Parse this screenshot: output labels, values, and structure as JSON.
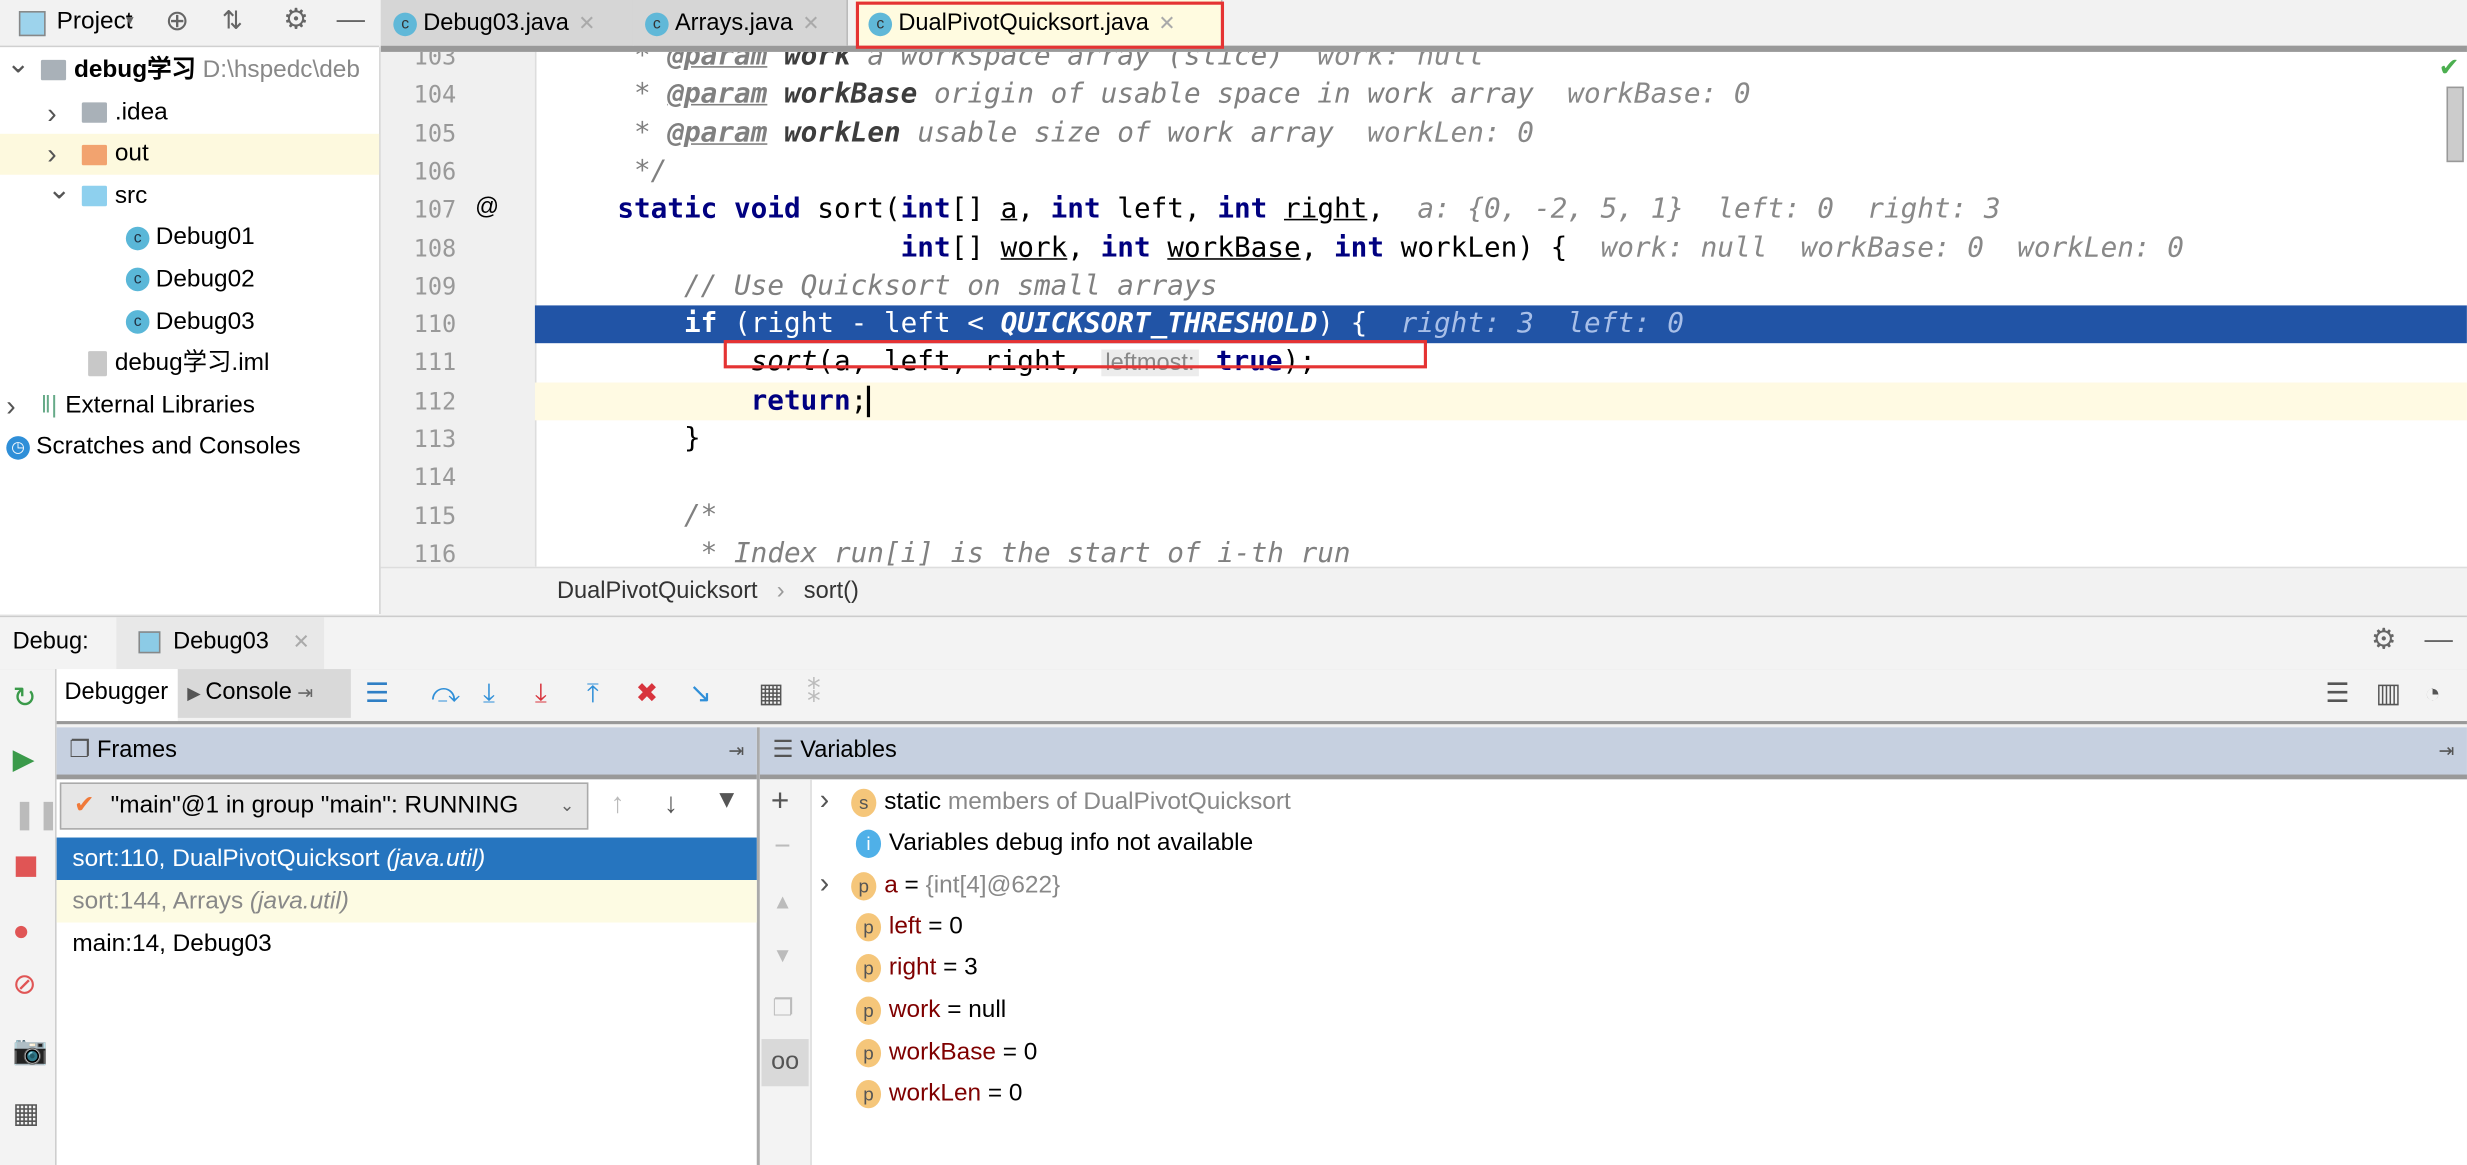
{
  "project_bar": {
    "label": "Project",
    "icons": [
      "locate-icon",
      "collapse-icon",
      "gear-icon",
      "minimize-icon"
    ]
  },
  "tabs": [
    {
      "label": "Debug03.java",
      "active": false
    },
    {
      "label": "Arrays.java",
      "active": false
    },
    {
      "label": "DualPivotQuicksort.java",
      "active": true
    }
  ],
  "tree": [
    {
      "label": "debug学习",
      "extra": "D:\\hspedc\\deb",
      "type": "module",
      "expanded": true
    },
    {
      "label": ".idea",
      "type": "folder-gray",
      "expanded": false
    },
    {
      "label": "out",
      "type": "folder-orange",
      "expanded": false
    },
    {
      "label": "src",
      "type": "folder-blue",
      "expanded": true
    },
    {
      "label": "Debug01",
      "type": "class"
    },
    {
      "label": "Debug02",
      "type": "class"
    },
    {
      "label": "Debug03",
      "type": "class"
    },
    {
      "label": "debug学习.iml",
      "type": "file"
    },
    {
      "label": "External Libraries",
      "type": "libs",
      "expanded": false
    },
    {
      "label": "Scratches and Consoles",
      "type": "scratch"
    }
  ],
  "editor": {
    "lines": [
      {
        "n": "103",
        "tokens": [
          {
            "t": "     * ",
            "c": "cm"
          },
          {
            "t": "@param",
            "c": "tag"
          },
          {
            "t": " work",
            "c": "tagv"
          },
          {
            "t": " a workspace array (slice)",
            "c": "cm"
          },
          {
            "t": "  work: null",
            "c": "hint"
          }
        ]
      },
      {
        "n": "104",
        "tokens": [
          {
            "t": "     * ",
            "c": "cm"
          },
          {
            "t": "@param",
            "c": "tag"
          },
          {
            "t": " workBase",
            "c": "tagv"
          },
          {
            "t": " origin of usable space in work array",
            "c": "cm"
          },
          {
            "t": "  workBase: 0",
            "c": "hint"
          }
        ]
      },
      {
        "n": "105",
        "tokens": [
          {
            "t": "     * ",
            "c": "cm"
          },
          {
            "t": "@param",
            "c": "tag"
          },
          {
            "t": " workLen",
            "c": "tagv"
          },
          {
            "t": " usable size of work array",
            "c": "cm"
          },
          {
            "t": "  workLen: 0",
            "c": "hint"
          }
        ]
      },
      {
        "n": "106",
        "tokens": [
          {
            "t": "     */",
            "c": "cm"
          }
        ]
      },
      {
        "n": "107",
        "marker": "@",
        "tokens": [
          {
            "t": "    "
          },
          {
            "t": "static void ",
            "c": "kw"
          },
          {
            "t": "sort("
          },
          {
            "t": "int",
            "c": "kw"
          },
          {
            "t": "[] "
          },
          {
            "t": "a",
            "c": "ul"
          },
          {
            "t": ", "
          },
          {
            "t": "int",
            "c": "kw"
          },
          {
            "t": " left, "
          },
          {
            "t": "int",
            "c": "kw"
          },
          {
            "t": " "
          },
          {
            "t": "right",
            "c": "ul"
          },
          {
            "t": ",  "
          },
          {
            "t": "a: {0, -2, 5, 1}  left: 0  right: 3",
            "c": "hint"
          }
        ]
      },
      {
        "n": "108",
        "tokens": [
          {
            "t": "                     "
          },
          {
            "t": "int",
            "c": "kw"
          },
          {
            "t": "[] "
          },
          {
            "t": "work",
            "c": "ul"
          },
          {
            "t": ", "
          },
          {
            "t": "int",
            "c": "kw"
          },
          {
            "t": " "
          },
          {
            "t": "workBase",
            "c": "ul"
          },
          {
            "t": ", "
          },
          {
            "t": "int",
            "c": "kw"
          },
          {
            "t": " workLen) {  "
          },
          {
            "t": "work: null  workBase: 0  workLen: 0",
            "c": "hint"
          }
        ]
      },
      {
        "n": "109",
        "tokens": [
          {
            "t": "        "
          },
          {
            "t": "// Use Quicksort on small arrays",
            "c": "cm"
          }
        ]
      },
      {
        "n": "110",
        "state": "execution",
        "tokens": [
          {
            "t": "        "
          },
          {
            "t": "if",
            "c": "kw"
          },
          {
            "t": " (right - left < "
          },
          {
            "t": "QUICKSORT_THRESHOLD",
            "c": "cst"
          },
          {
            "t": ") {  "
          },
          {
            "t": "right: 3  left: 0",
            "c": "hint"
          }
        ]
      },
      {
        "n": "111",
        "tokens": [
          {
            "t": "            "
          },
          {
            "t": "sort",
            "c": "fn"
          },
          {
            "t": "(a, left, right, "
          },
          {
            "t": "leftmost:",
            "c": "phint"
          },
          {
            "t": " "
          },
          {
            "t": "true",
            "c": "kw"
          },
          {
            "t": ");"
          }
        ]
      },
      {
        "n": "112",
        "state": "caret",
        "tokens": [
          {
            "t": "            "
          },
          {
            "t": "return",
            "c": "kw"
          },
          {
            "t": ";"
          }
        ]
      },
      {
        "n": "113",
        "tokens": [
          {
            "t": "        }"
          }
        ]
      },
      {
        "n": "114",
        "tokens": []
      },
      {
        "n": "115",
        "tokens": [
          {
            "t": "        "
          },
          {
            "t": "/*",
            "c": "cm"
          }
        ]
      },
      {
        "n": "116",
        "tokens": [
          {
            "t": "         "
          },
          {
            "t": "* Index run[i] is the start of i-th run",
            "c": "cm"
          }
        ]
      }
    ],
    "breadcrumb": [
      "DualPivotQuicksort",
      "sort()"
    ]
  },
  "debug": {
    "label": "Debug:",
    "session": "Debug03",
    "tabs": [
      "Debugger",
      "Console"
    ],
    "toolbar": [
      "show-execution-point-icon",
      "step-over-icon",
      "step-into-icon",
      "force-step-into-icon",
      "step-out-icon",
      "drop-frame-icon",
      "run-to-cursor-icon",
      "evaluate-expression-icon",
      "trace-icon"
    ],
    "frames": {
      "title": "Frames",
      "thread": "\"main\"@1 in group \"main\": RUNNING",
      "items": [
        {
          "text": "sort:110, DualPivotQuicksort",
          "pkg": "(java.util)",
          "state": "selected"
        },
        {
          "text": "sort:144, Arrays",
          "pkg": "(java.util)",
          "state": "library"
        },
        {
          "text": "main:14, Debug03",
          "pkg": "",
          "state": "normal"
        }
      ]
    },
    "variables": {
      "title": "Variables",
      "items": [
        {
          "badge": "s",
          "name": "static",
          "value": "members of DualPivotQuicksort",
          "expandable": true,
          "kind": "static"
        },
        {
          "badge": "i",
          "name": "",
          "value": "Variables debug info not available",
          "expandable": false,
          "kind": "info"
        },
        {
          "badge": "p",
          "name": "a",
          "value": " = {int[4]@622}",
          "expandable": true,
          "kind": "obj"
        },
        {
          "badge": "p",
          "name": "left",
          "value": " = 0",
          "expandable": false,
          "kind": "prim"
        },
        {
          "badge": "p",
          "name": "right",
          "value": " = 3",
          "expandable": false,
          "kind": "prim"
        },
        {
          "badge": "p",
          "name": "work",
          "value": " = null",
          "expandable": false,
          "kind": "prim"
        },
        {
          "badge": "p",
          "name": "workBase",
          "value": " = 0",
          "expandable": false,
          "kind": "prim"
        },
        {
          "badge": "p",
          "name": "workLen",
          "value": " = 0",
          "expandable": false,
          "kind": "prim"
        }
      ]
    }
  },
  "colors": {
    "execution_line": "#2154a6",
    "selected_frame": "#2675bf",
    "highlight_box": "#e53333",
    "caret_line": "#fffae3"
  }
}
